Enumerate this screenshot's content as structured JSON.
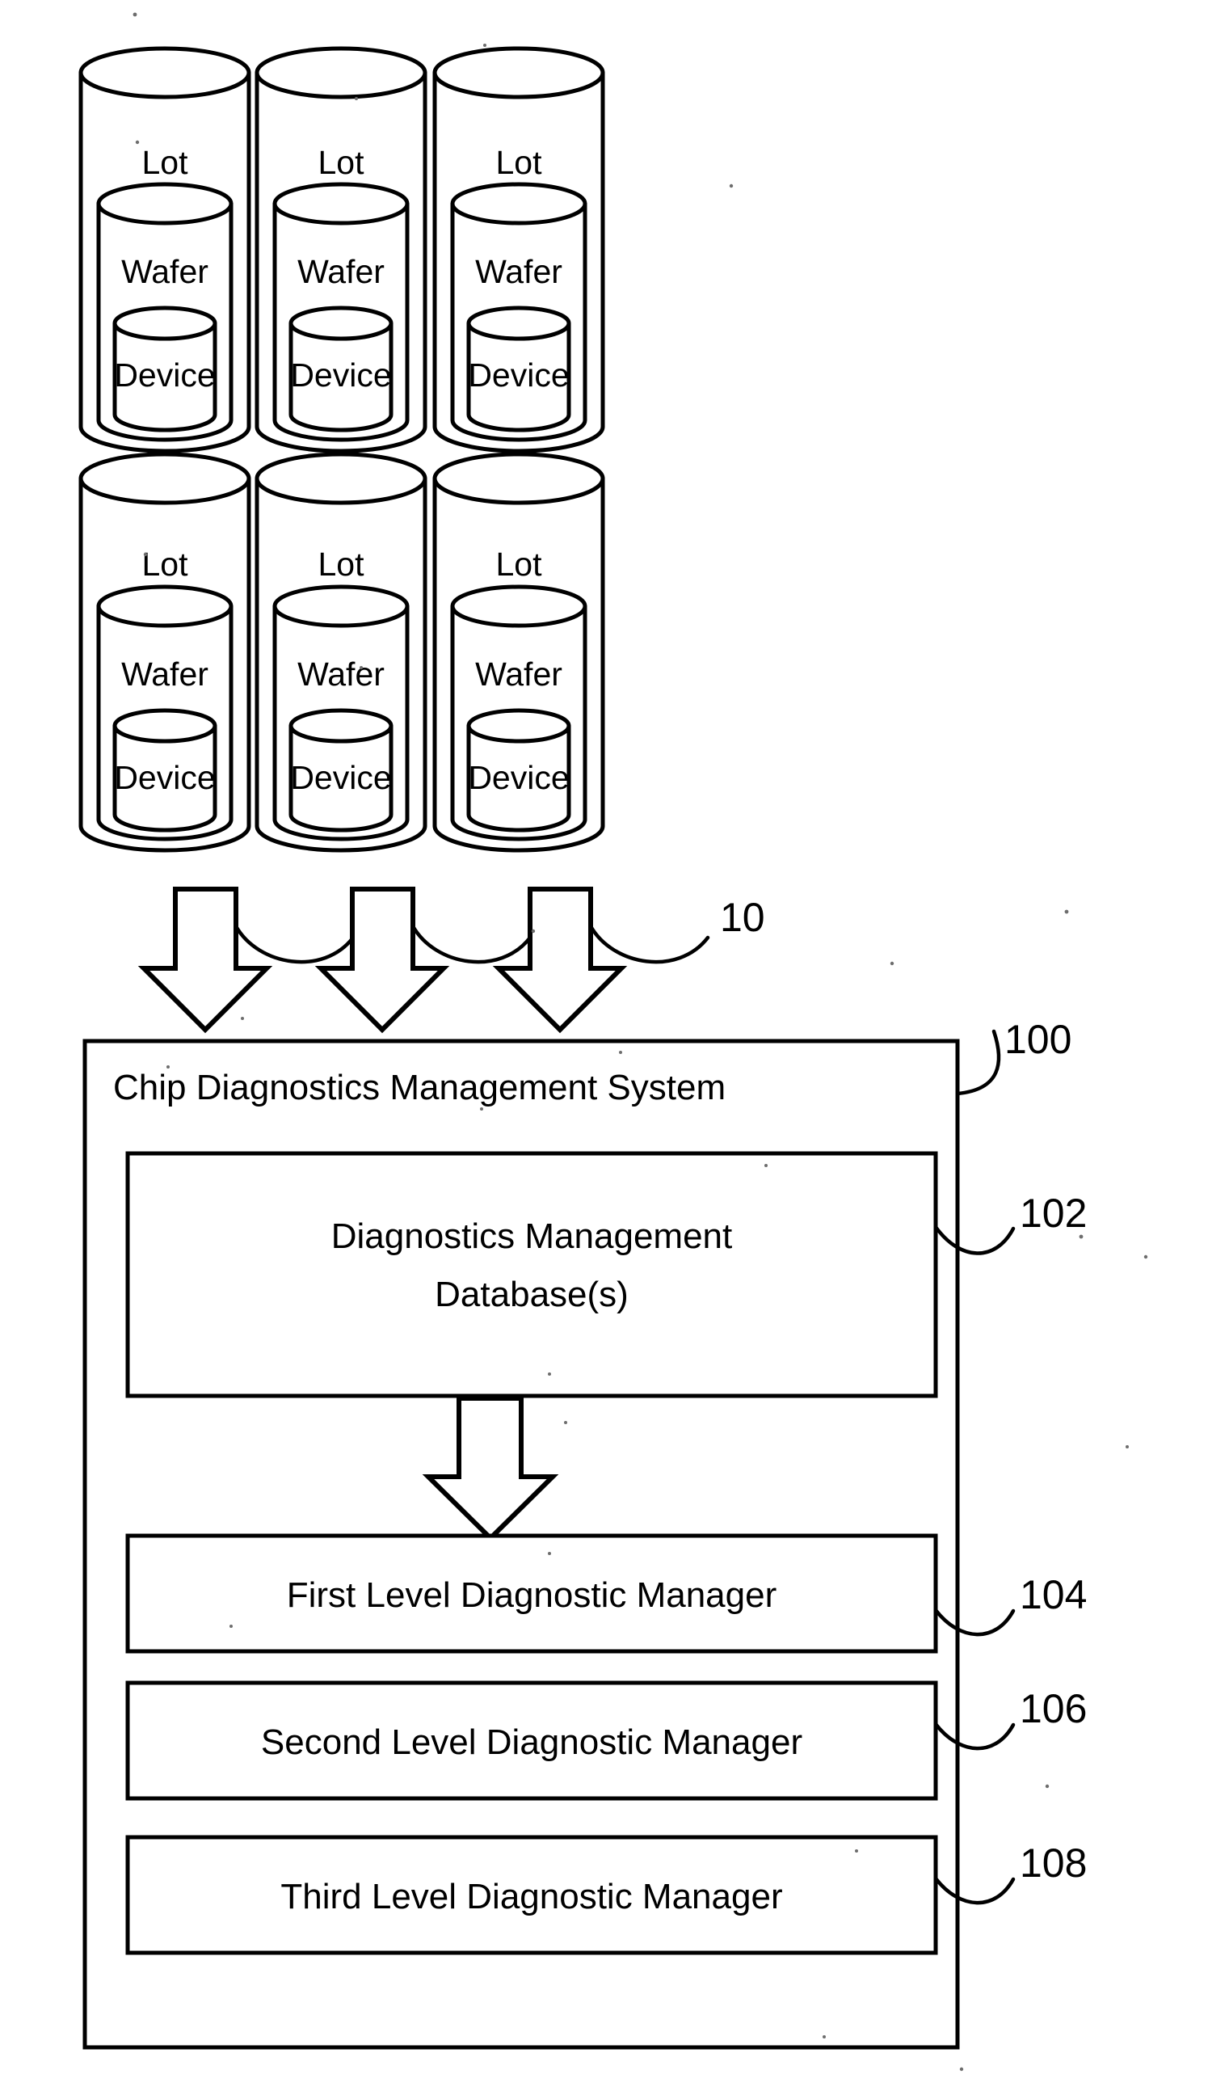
{
  "figure": {
    "type": "patent-block-diagram",
    "background_color": "#ffffff",
    "line_color": "#000000"
  },
  "data_sources": {
    "rows": 2,
    "columns": 3,
    "stack_labels": {
      "outer": "Lot",
      "middle": "Wafer",
      "inner": "Device"
    },
    "items": [
      {
        "outer": "Lot",
        "middle": "Wafer",
        "inner": "Device"
      },
      {
        "outer": "Lot",
        "middle": "Wafer",
        "inner": "Device"
      },
      {
        "outer": "Lot",
        "middle": "Wafer",
        "inner": "Device"
      },
      {
        "outer": "Lot",
        "middle": "Wafer",
        "inner": "Device"
      },
      {
        "outer": "Lot",
        "middle": "Wafer",
        "inner": "Device"
      },
      {
        "outer": "Lot",
        "middle": "Wafer",
        "inner": "Device"
      }
    ]
  },
  "flow_arrows": [
    {
      "ref": "10"
    },
    {
      "ref": "10"
    },
    {
      "ref": "10"
    }
  ],
  "system": {
    "title": "Chip Diagnostics Management System",
    "ref": "100",
    "database": {
      "line1": "Diagnostics Management",
      "line2": "Database(s)",
      "ref": "102"
    },
    "internal_arrow": {
      "ref": ""
    },
    "managers": [
      {
        "label": "First Level Diagnostic Manager",
        "ref": "104"
      },
      {
        "label": "Second Level Diagnostic Manager",
        "ref": "106"
      },
      {
        "label": "Third Level Diagnostic Manager",
        "ref": "108"
      }
    ]
  }
}
